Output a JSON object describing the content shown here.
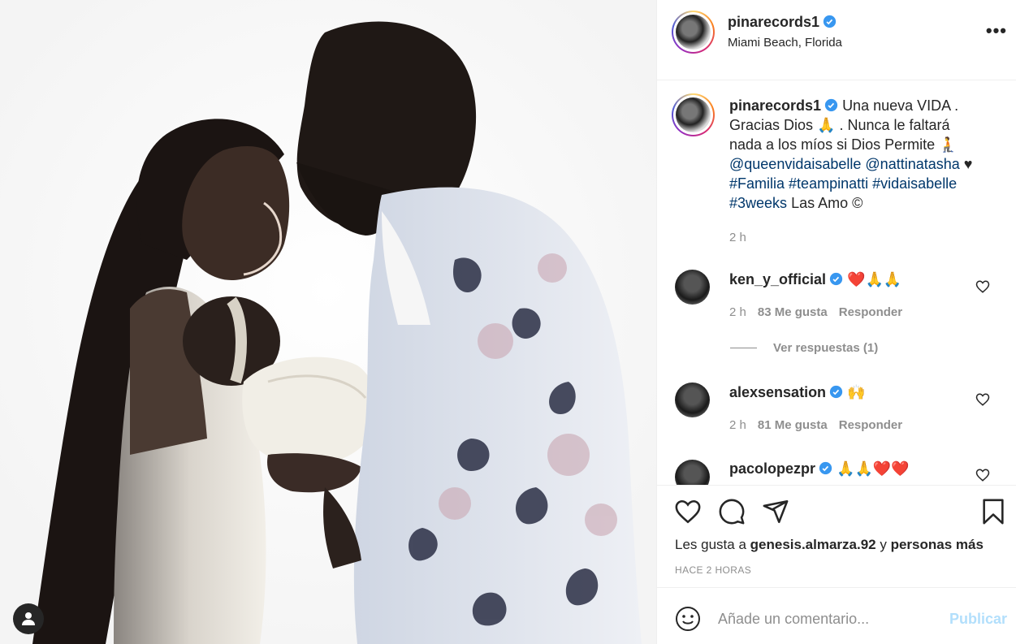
{
  "post": {
    "username": "pinarecords1",
    "location": "Miami Beach, Florida",
    "more_label": "•••",
    "caption_line1": "Una nueva VIDA .",
    "caption_line2": "Gracias Dios 🙏 . Nunca le faltará",
    "caption_line3": "nada a los míos si Dios Permite 🧎",
    "mention1": "@queenvidaisabelle",
    "mention2": "@nattinatasha",
    "caption_heart": "♥",
    "tag1": "#Familia",
    "tag2": "#teampinatti",
    "tag3": "#vidaisabelle",
    "tag4": "#3weeks",
    "caption_end": "Las Amo ©",
    "caption_time": "2 h"
  },
  "comments": [
    {
      "username": "ken_y_official",
      "text": "❤️🙏🙏",
      "time": "2 h",
      "likes": "83 Me gusta",
      "reply": "Responder"
    },
    {
      "username": "alexsensation",
      "text": "🙌",
      "time": "2 h",
      "likes": "81 Me gusta",
      "reply": "Responder"
    },
    {
      "username": "pacolopezpr",
      "text": "🙏🙏❤️❤️"
    }
  ],
  "view_replies": "Ver respuestas (1)",
  "likes_line": {
    "prefix": "Les gusta a",
    "user": "genesis.almarza.92",
    "middle": "y",
    "suffix": "personas más"
  },
  "timestamp": "HACE 2 HORAS",
  "comment_box": {
    "placeholder": "Añade un comentario...",
    "publish": "Publicar"
  },
  "colors": {
    "verified": "#3897f0",
    "link": "#00376b",
    "muted": "#8e8e8e",
    "publish_disabled": "#b2dffc"
  }
}
